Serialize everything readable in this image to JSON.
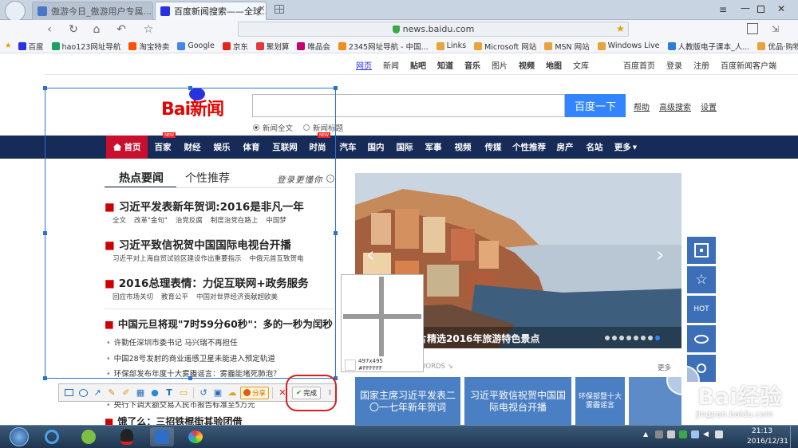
{
  "browser": {
    "tabs": [
      {
        "label": "傲游今日_傲游用户专属..."
      },
      {
        "label": "百度新闻搜索——全球..."
      }
    ],
    "url": "news.baidu.com",
    "bookmarks": [
      "百度",
      "hao123网址导航",
      "淘宝特卖",
      "Google",
      "京东",
      "聚划算",
      "唯品会",
      "2345网址导航 - 中国...",
      "Links",
      "Microsoft 网站",
      "MSN 网站",
      "Windows Live",
      "人教版电子课本_人...",
      "优品·购物"
    ]
  },
  "header": {
    "top_links_left": [
      "网页",
      "新闻",
      "贴吧",
      "知道",
      "音乐",
      "图片",
      "视频",
      "地图",
      "文库"
    ],
    "top_links_right": [
      "百度首页",
      "登录",
      "注册",
      "百度新闻客户端"
    ],
    "logo_text": "Bai新闻",
    "search_button": "百度一下",
    "side_links": [
      "帮助",
      "高级搜索",
      "设置"
    ],
    "radio_all": "新闻全文",
    "radio_title": "新闻标题"
  },
  "main_nav": {
    "items": [
      "首页",
      "百家",
      "财经",
      "娱乐",
      "体育",
      "互联网",
      "时尚",
      "汽车",
      "国内",
      "国际",
      "军事",
      "视频",
      "传媒",
      "个性推荐",
      "房产",
      "名站",
      "更多"
    ],
    "new_badge": "NEW"
  },
  "news": {
    "tab_hot": "热点要闻",
    "tab_personal": "个性推荐",
    "login_prompt": "登录更懂你",
    "headlines": [
      {
        "title": "习近平发表新年贺词:2016是非凡一年",
        "subs": [
          "全文",
          "改革\"金句\"",
          "治党反腐",
          "制度治党在路上",
          "中国梦"
        ]
      },
      {
        "title": "习近平致信祝贺中国国际电视台开播",
        "subs": [
          "习近平对上海自贸试验区建设作出重要指示",
          "中俄元首互致贺电"
        ]
      },
      {
        "title": "2016总理表情：力促互联网+政务服务",
        "subs": [
          "回应市场关切",
          "教育公平",
          "中国对世界经济贡献超欧美"
        ]
      },
      {
        "title": "中国元旦将现\"7时59分60秒\"：多的一秒为闰秒",
        "subs": []
      }
    ],
    "list": [
      "许勤任深圳市委书记 马兴瑞不再担任",
      "中国28号发射的商业遥感卫星未能进入预定轨道",
      "环保部发布年度十大雾霾谣言：雾霾能堵死肺泡？",
      "央行下调大额交易人民币报告标准至5万元",
      "饿了么：三招铁棍街其验团借"
    ]
  },
  "slider": {
    "caption": "图片精选2016年旅游特色景点",
    "dots": 8,
    "active_dot": 7
  },
  "side_tools": [
    "二维码",
    "收藏",
    "HOT",
    "浏览",
    "搜索"
  ],
  "banners": [
    {
      "text": "国家主席习近平发表二〇一七年新年贺词"
    },
    {
      "text": "习近平致信祝贺中国国际电视台开播"
    },
    {
      "text": "环保部暨十大雾霾谣言"
    }
  ],
  "keywords_label": "WORDS",
  "more_label": "更多",
  "screenshot_tool": {
    "magnifier_size": "497x495",
    "magnifier_color": "#FFFFFF",
    "share_label": "分享",
    "done_label": "完成"
  },
  "watermark": {
    "brand": "Bai经验",
    "url": "jingyan.baidu.com"
  },
  "taskbar": {
    "time": "21:13",
    "date": "2016/12/31"
  },
  "colors": {
    "nav_bg": "#162b57",
    "accent_red": "#e10602",
    "search_blue": "#3385ff",
    "banner_blue": "#4a7fc4",
    "highlight_circle": "#d81e1e"
  }
}
